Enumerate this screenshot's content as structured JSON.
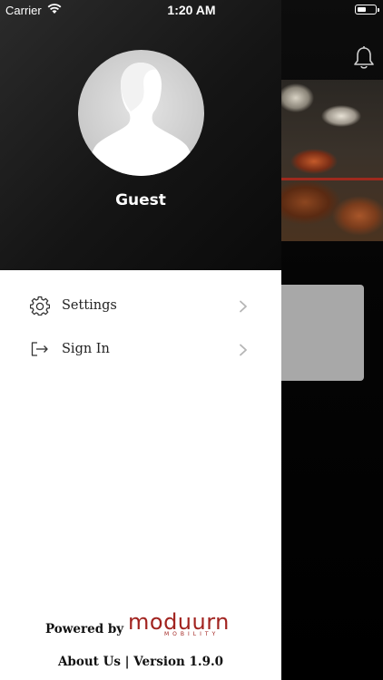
{
  "status_bar": {
    "carrier": "Carrier",
    "time": "1:20 AM"
  },
  "drawer": {
    "user_name": "Guest",
    "menu": [
      {
        "label": "Settings",
        "icon": "gear-icon"
      },
      {
        "label": "Sign In",
        "icon": "sign-in-icon"
      }
    ],
    "footer": {
      "powered_by": "Powered by",
      "brand_name": "moduurn",
      "brand_sub": "MOBILITY",
      "about_version": "About Us | Version 1.9.0"
    }
  },
  "colors": {
    "brand": "#a1231f",
    "header_bg": "#1a1a1a"
  },
  "icons": [
    "wifi-icon",
    "battery-icon",
    "bell-icon",
    "avatar-placeholder-icon",
    "gear-icon",
    "sign-in-icon",
    "chevron-right-icon"
  ]
}
